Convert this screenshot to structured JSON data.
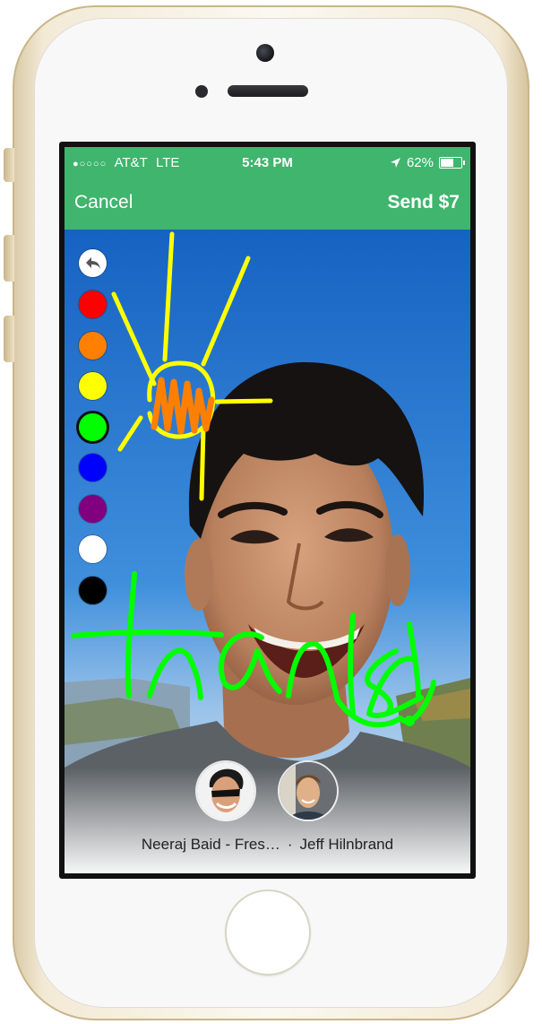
{
  "status_bar": {
    "signal": "●○○○○",
    "carrier": "AT&T",
    "network": "LTE",
    "time": "5:43 PM",
    "battery": "62%"
  },
  "nav": {
    "cancel_label": "Cancel",
    "send_label": "Send $7"
  },
  "palette": {
    "colors": [
      {
        "name": "red",
        "hex": "#ff0000"
      },
      {
        "name": "orange",
        "hex": "#ff7f00"
      },
      {
        "name": "yellow",
        "hex": "#ffff00"
      },
      {
        "name": "green",
        "hex": "#00ff00"
      },
      {
        "name": "blue",
        "hex": "#0000ff"
      },
      {
        "name": "purple",
        "hex": "#800080"
      },
      {
        "name": "white",
        "hex": "#ffffff"
      },
      {
        "name": "black",
        "hex": "#000000"
      }
    ],
    "selected": "green"
  },
  "recipients": {
    "names": [
      "Neeraj Baid - Fres…",
      "Jeff Hilnbrand"
    ],
    "separator": "·"
  },
  "accent": "#3fb56d"
}
